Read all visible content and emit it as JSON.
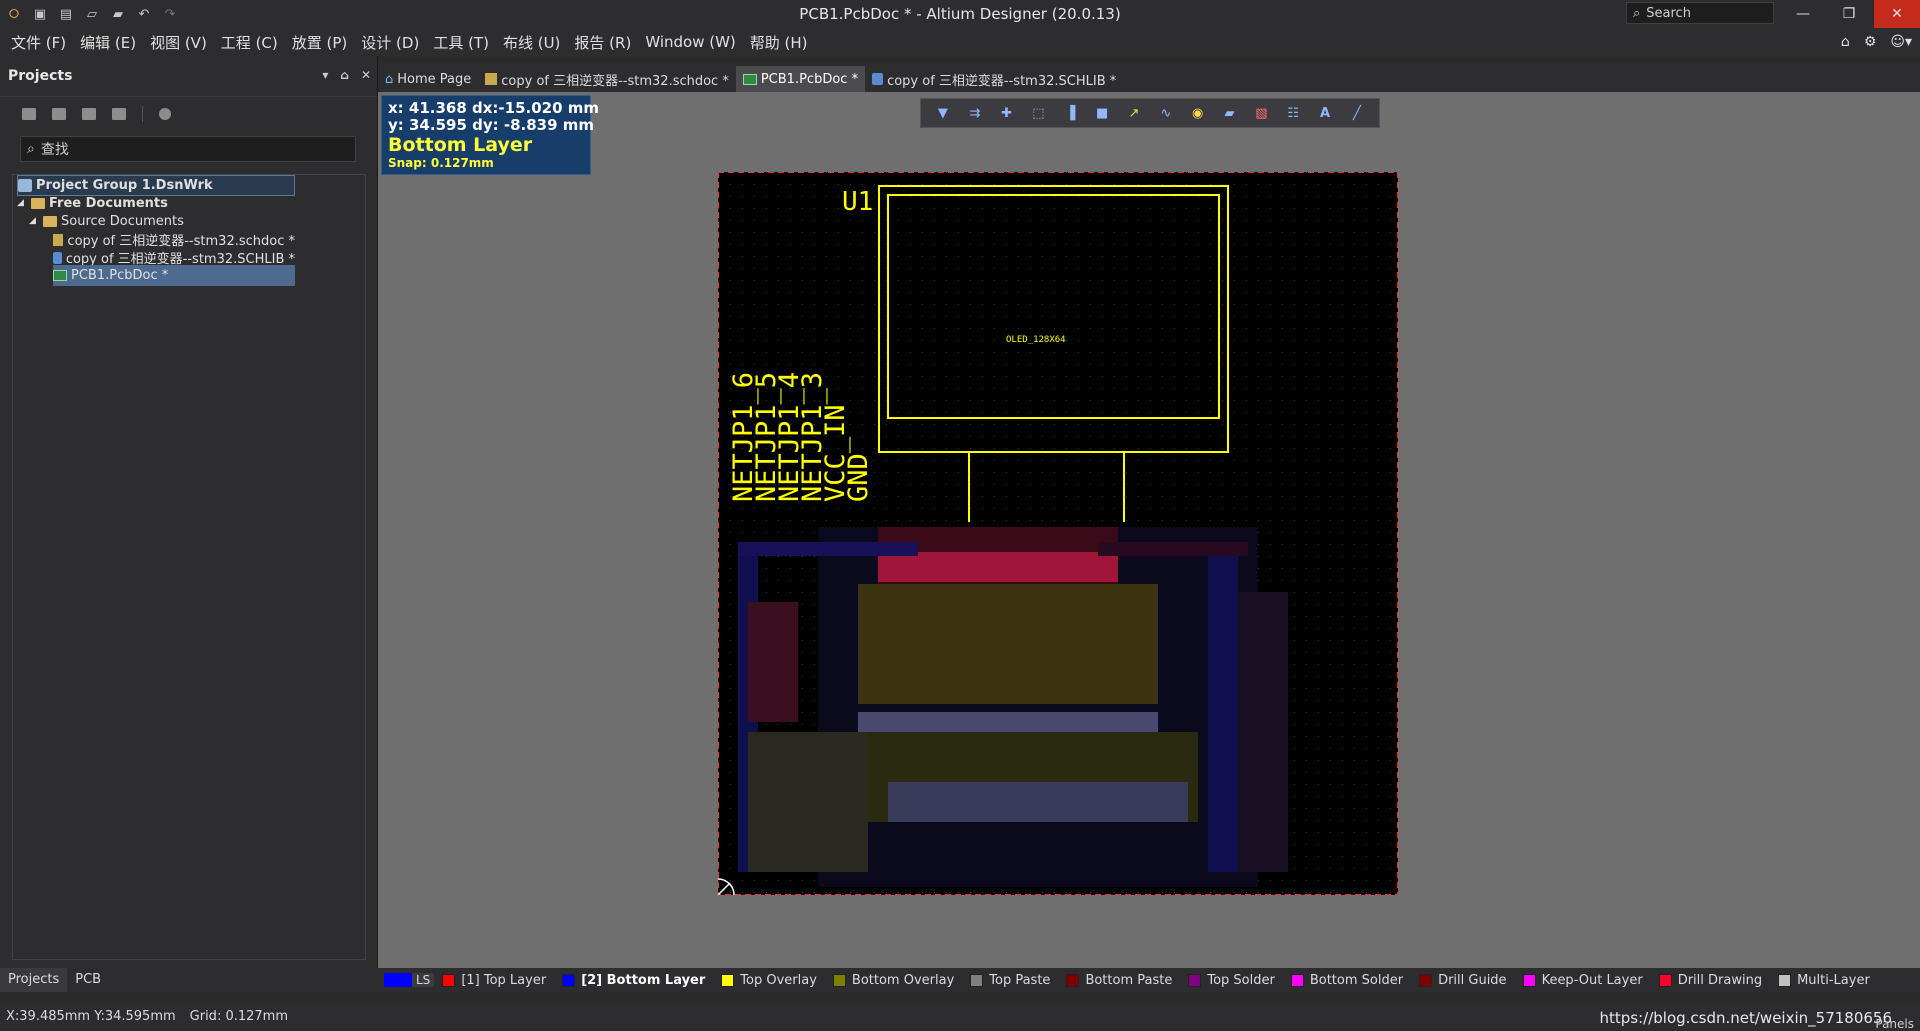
{
  "titlebar": {
    "title": "PCB1.PcbDoc * - Altium Designer (20.0.13)",
    "search_placeholder": "Search",
    "quick_icons": [
      "altium-logo-icon",
      "save-icon",
      "save-all-icon",
      "open-icon",
      "open-project-icon",
      "undo-icon",
      "redo-icon"
    ]
  },
  "menubar": {
    "items": [
      "文件 (F)",
      "编辑 (E)",
      "视图 (V)",
      "工程 (C)",
      "放置 (P)",
      "设计 (D)",
      "工具 (T)",
      "布线 (U)",
      "报告 (R)",
      "Window (W)",
      "帮助 (H)"
    ]
  },
  "projects_panel": {
    "title": "Projects",
    "search_placeholder": "查找",
    "tree": [
      {
        "label": "Project Group 1.DsnWrk",
        "icon": "workspace-icon",
        "level": 0,
        "bold": true,
        "style": "group"
      },
      {
        "label": "Free Documents",
        "icon": "folder-icon",
        "level": 1,
        "bold": true,
        "style": "normal"
      },
      {
        "label": "Source Documents",
        "icon": "folder-icon",
        "level": 2,
        "bold": false,
        "style": "normal"
      },
      {
        "label": "copy of 三相逆变器--stm32.schdoc *",
        "icon": "schdoc-icon",
        "level": 3,
        "bold": false,
        "style": "normal"
      },
      {
        "label": "copy of 三相逆变器--stm32.SCHLIB *",
        "icon": "schlib-icon",
        "level": 3,
        "bold": false,
        "style": "normal"
      },
      {
        "label": "PCB1.PcbDoc *",
        "icon": "pcbdoc-icon",
        "level": 3,
        "bold": false,
        "style": "selected"
      }
    ],
    "bottom_tabs": [
      "Projects",
      "PCB"
    ]
  },
  "doc_tabs": [
    {
      "label": "Home Page",
      "icon": "home-icon",
      "active": false
    },
    {
      "label": "copy of 三相逆变器--stm32.schdoc *",
      "icon": "schdoc-icon",
      "active": false
    },
    {
      "label": "PCB1.PcbDoc *",
      "icon": "pcbdoc-icon",
      "active": true
    },
    {
      "label": "copy of 三相逆变器--stm32.SCHLIB *",
      "icon": "schlib-icon",
      "active": false
    }
  ],
  "coord_overlay": {
    "line1": "x: 41.368   dx:-15.020 mm",
    "line2": "y: 34.595   dy: -8.839  mm",
    "layer": "Bottom Layer",
    "snap": "Snap: 0.127mm"
  },
  "pcb": {
    "designator": "U1",
    "component_comment": "OLED_128X64",
    "net_labels": [
      "NETJP1_6",
      "NETJP1_5",
      "NETJP1_4",
      "NETJP1_3",
      "VCC_IN",
      "GND"
    ]
  },
  "layer_tabs": {
    "ls_label": "LS",
    "layers": [
      {
        "label": "[1] Top Layer",
        "color": "#ff0000",
        "active": false
      },
      {
        "label": "[2] Bottom Layer",
        "color": "#0000ff",
        "active": true
      },
      {
        "label": "Top Overlay",
        "color": "#ffff00",
        "active": false
      },
      {
        "label": "Bottom Overlay",
        "color": "#808000",
        "active": false
      },
      {
        "label": "Top Paste",
        "color": "#808080",
        "active": false
      },
      {
        "label": "Bottom Paste",
        "color": "#800000",
        "active": false
      },
      {
        "label": "Top Solder",
        "color": "#800080",
        "active": false
      },
      {
        "label": "Bottom Solder",
        "color": "#ff00ff",
        "active": false
      },
      {
        "label": "Drill Guide",
        "color": "#800000",
        "active": false
      },
      {
        "label": "Keep-Out Layer",
        "color": "#ff00ff",
        "active": false
      },
      {
        "label": "Drill Drawing",
        "color": "#ff002a",
        "active": false
      },
      {
        "label": "Multi-Layer",
        "color": "#c0c0c0",
        "active": false
      }
    ]
  },
  "statusbar": {
    "coords": "X:39.485mm Y:34.595mm",
    "grid": "Grid: 0.127mm",
    "watermark": "https://blog.csdn.net/weixin_57180656",
    "panels": "Panels"
  }
}
